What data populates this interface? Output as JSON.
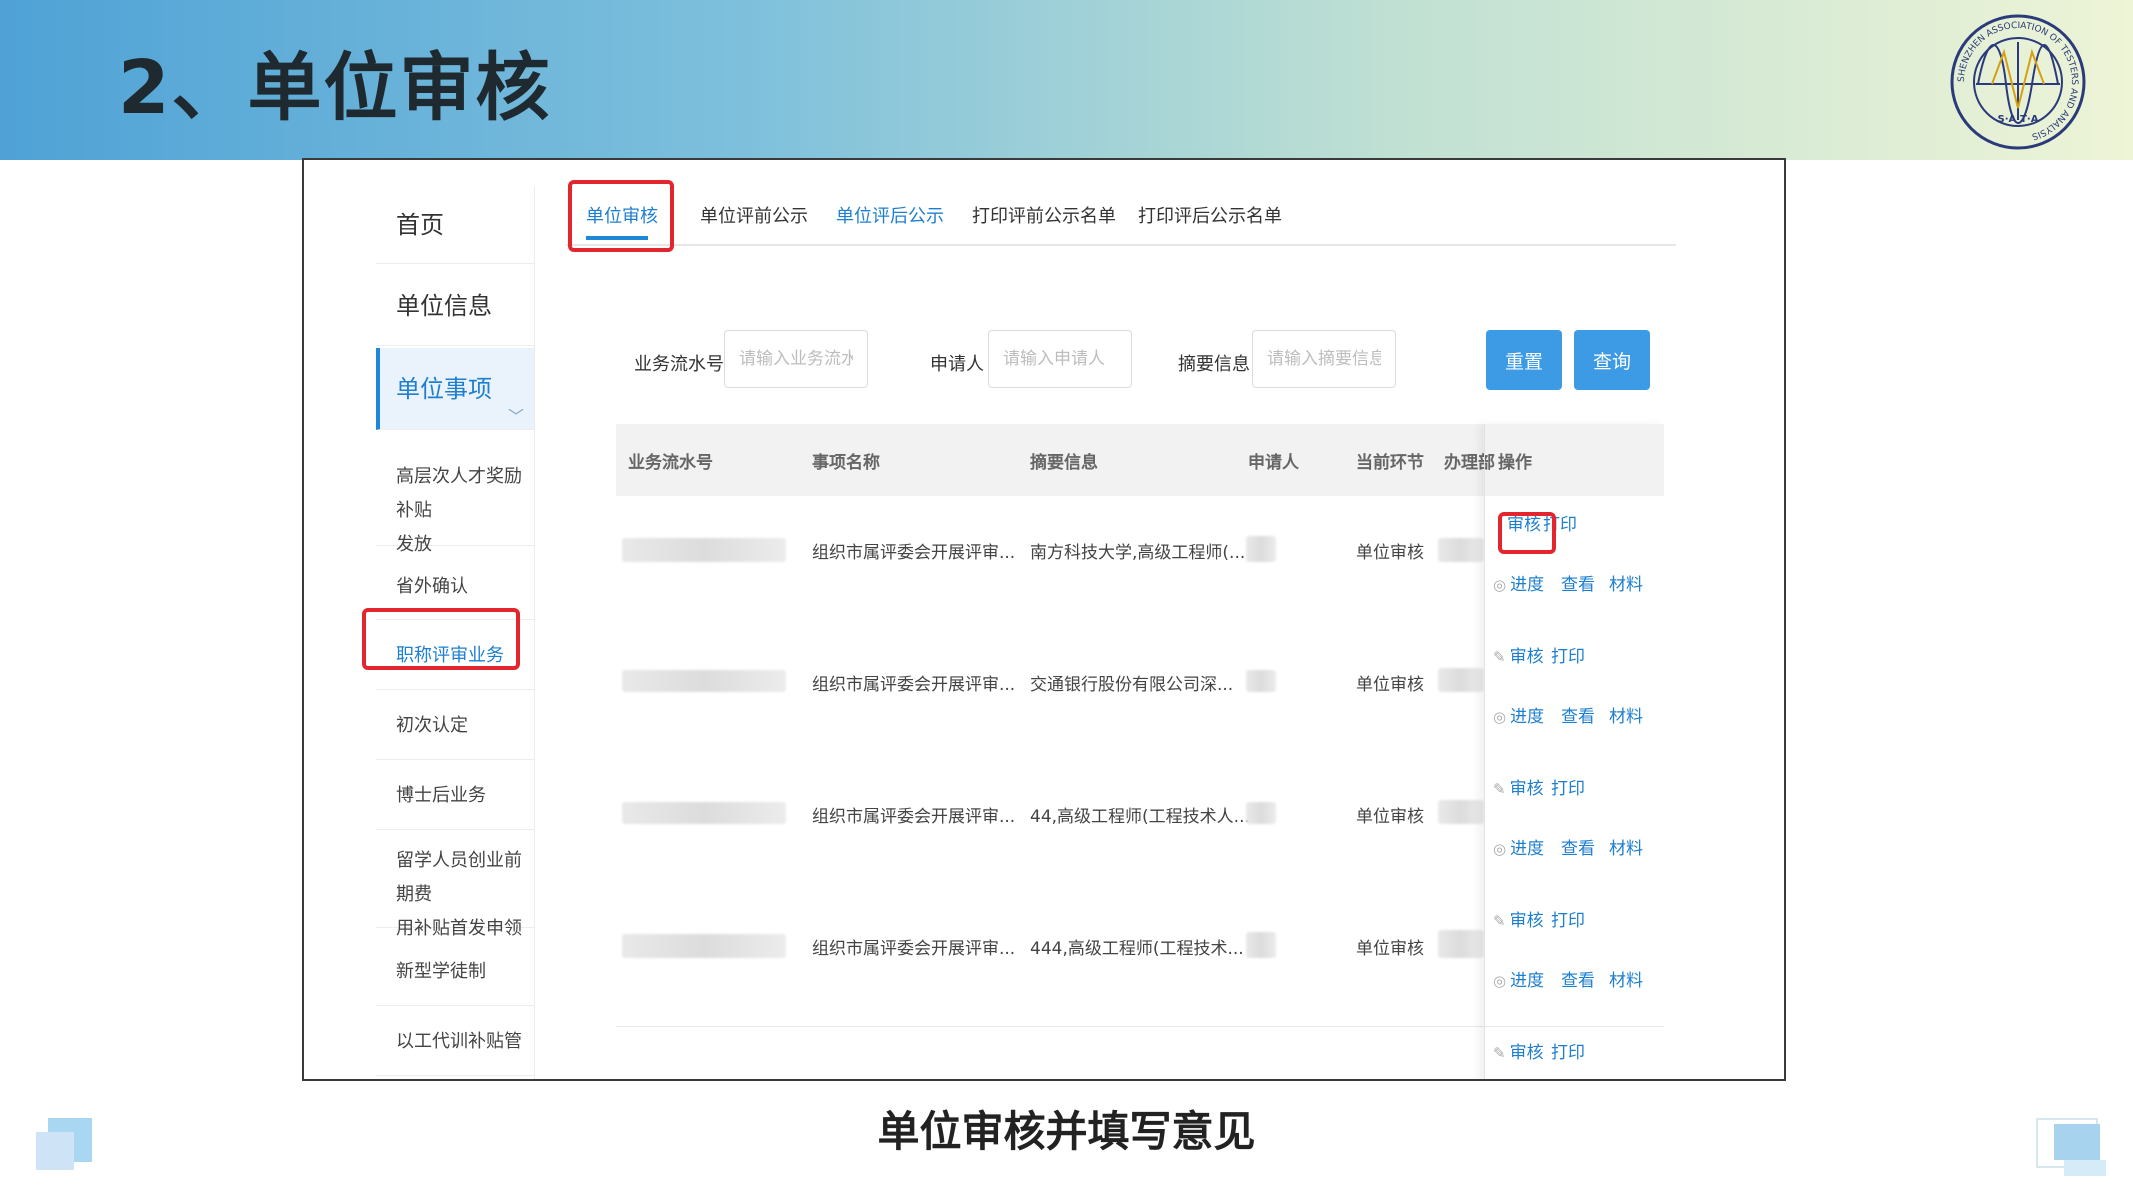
{
  "slide": {
    "title": "2、单位审核",
    "caption": "单位审核并填写意见",
    "logo_text": "SHENZHEN ASSOCIATION OF TESTERS AND ANALYSIS",
    "logo_letters": "S·A·T·A"
  },
  "tabs": [
    {
      "label": "单位审核"
    },
    {
      "label": "单位评前公示"
    },
    {
      "label": "单位评后公示"
    },
    {
      "label": "打印评前公示名单"
    },
    {
      "label": "打印评后公示名单"
    }
  ],
  "sidebar": {
    "items": [
      {
        "label": "首页"
      },
      {
        "label": "单位信息"
      },
      {
        "label": "单位事项"
      },
      {
        "label_line1": "高层次人才奖励补贴",
        "label_line2": "发放"
      },
      {
        "label": "省外确认"
      },
      {
        "label": "职称评审业务"
      },
      {
        "label": "初次认定"
      },
      {
        "label": "博士后业务"
      },
      {
        "label_line1": "留学人员创业前期费",
        "label_line2": "用补贴首发申领"
      },
      {
        "label": "新型学徒制"
      },
      {
        "label": "以工代训补贴管理"
      }
    ]
  },
  "search": {
    "flow_label": "业务流水号",
    "flow_placeholder": "请输入业务流水",
    "applicant_label": "申请人",
    "applicant_placeholder": "请输入申请人",
    "summary_label": "摘要信息",
    "summary_placeholder": "请输入摘要信息",
    "reset": "重置",
    "query": "查询"
  },
  "table": {
    "headers": [
      "业务流水号",
      "事项名称",
      "摘要信息",
      "申请人",
      "当前环节",
      "办理部",
      "操作"
    ],
    "rows": [
      {
        "item": "组织市属评委会开展评审...",
        "summary": "南方科技大学,高级工程师(...",
        "stage": "单位审核"
      },
      {
        "item": "组织市属评委会开展评审...",
        "summary": "交通银行股份有限公司深...",
        "stage": "单位审核"
      },
      {
        "item": "组织市属评委会开展评审...",
        "summary": "44,高级工程师(工程技术人...",
        "stage": "单位审核"
      },
      {
        "item": "组织市属评委会开展评审...",
        "summary": "444,高级工程师(工程技术...",
        "stage": "单位审核"
      }
    ],
    "ops": {
      "review": "审核",
      "print": "打印",
      "progress": "进度",
      "view": "查看",
      "material": "材料"
    }
  }
}
